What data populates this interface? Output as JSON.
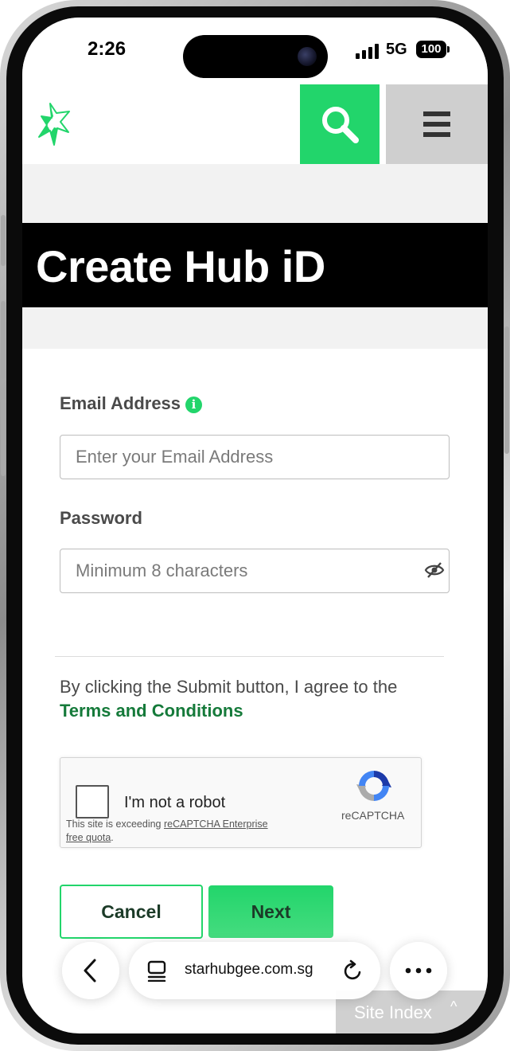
{
  "status_bar": {
    "time": "2:26",
    "network": "5G",
    "battery": "100"
  },
  "header": {
    "logo": "starhub-star-logo",
    "search_icon": "search-icon",
    "menu_icon": "hamburger-menu-icon",
    "accent_color": "#22d56b"
  },
  "page": {
    "title": "Create Hub iD"
  },
  "form": {
    "email_label": "Email Address",
    "email_info_icon": "i",
    "email_placeholder": "Enter your Email Address",
    "password_label": "Password",
    "password_placeholder": "Minimum 8 characters",
    "terms_prefix": "By clicking the Submit button, I agree to the",
    "terms_link": "Terms and Conditions"
  },
  "captcha": {
    "checkbox_label": "I'm not a robot",
    "warning_prefix": "This site is exceeding ",
    "warning_link": "reCAPTCHA Enterprise free quota",
    "warning_suffix": ".",
    "brand": "reCAPTCHA"
  },
  "actions": {
    "cancel_label": "Cancel",
    "next_label": "Next"
  },
  "footer": {
    "site_index_label": "Site Index",
    "site_index_caret": "^"
  },
  "browser": {
    "url": "starhubgee.com.sg"
  }
}
